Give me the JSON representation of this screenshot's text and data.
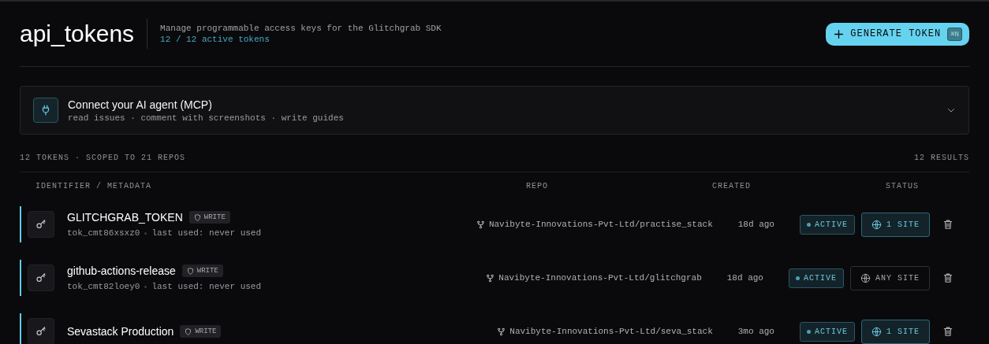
{
  "header": {
    "title": "api_tokens",
    "description": "Manage programmable access keys for the Glitchgrab SDK",
    "active_count": "12 / 12 active tokens",
    "generate_button": {
      "label": "GENERATE TOKEN",
      "shortcut": "⌘N"
    }
  },
  "mcp_panel": {
    "title": "Connect your AI agent (MCP)",
    "subtitle": "read issues · comment with screenshots · write guides",
    "expanded": false
  },
  "summary": {
    "left": "12 TOKENS · SCOPED TO 21 REPOS",
    "right": "12 RESULTS"
  },
  "table": {
    "columns": [
      "IDENTIFIER / METADATA",
      "REPO",
      "CREATED",
      "STATUS"
    ],
    "rows": [
      {
        "name": "GLITCHGRAB_TOKEN",
        "scope": "WRITE",
        "token_id": "tok_cmt86xsxz0",
        "last_used": "last used: never used",
        "repo": "Navibyte-Innovations-Pvt-Ltd/practise_stack",
        "created": "18d ago",
        "status": {
          "label": "ACTIVE",
          "kind": "active"
        },
        "site": {
          "label": "1 SITE",
          "kind": "scoped"
        }
      },
      {
        "name": "github-actions-release",
        "scope": "WRITE",
        "token_id": "tok_cmt82loey0",
        "last_used": "last used: never used",
        "repo": "Navibyte-Innovations-Pvt-Ltd/glitchgrab",
        "created": "18d ago",
        "status": {
          "label": "ACTIVE",
          "kind": "active"
        },
        "site": {
          "label": "ANY SITE",
          "kind": "any"
        }
      },
      {
        "name": "Sevastack Production",
        "scope": "WRITE",
        "repo": "Navibyte-Innovations-Pvt-Ltd/seva_stack",
        "created": "3mo ago",
        "status": {
          "label": "ACTIVE",
          "kind": "active"
        },
        "site": {
          "label": "1 SITE",
          "kind": "scoped"
        }
      }
    ]
  }
}
